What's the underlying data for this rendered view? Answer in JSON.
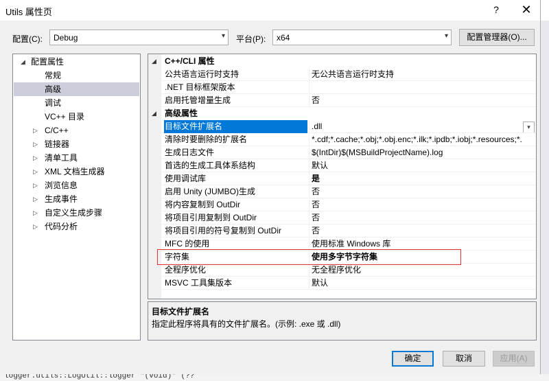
{
  "window": {
    "title": "Utils 属性页",
    "help_glyph": "?",
    "close_glyph": "✕"
  },
  "top": {
    "config_label": "配置(C):",
    "config_value": "Debug",
    "platform_label": "平台(P):",
    "platform_value": "x64",
    "config_manager_button": "配置管理器(O)..."
  },
  "tree": {
    "items": [
      {
        "label": "配置属性",
        "indent": 0,
        "twisty": "◢",
        "selected": false
      },
      {
        "label": "常规",
        "indent": 1,
        "twisty": "",
        "selected": false
      },
      {
        "label": "高级",
        "indent": 1,
        "twisty": "",
        "selected": true
      },
      {
        "label": "调试",
        "indent": 1,
        "twisty": "",
        "selected": false
      },
      {
        "label": "VC++ 目录",
        "indent": 1,
        "twisty": "",
        "selected": false
      },
      {
        "label": "C/C++",
        "indent": 1,
        "twisty": "▷",
        "selected": false
      },
      {
        "label": "链接器",
        "indent": 1,
        "twisty": "▷",
        "selected": false
      },
      {
        "label": "清单工具",
        "indent": 1,
        "twisty": "▷",
        "selected": false
      },
      {
        "label": "XML 文档生成器",
        "indent": 1,
        "twisty": "▷",
        "selected": false
      },
      {
        "label": "浏览信息",
        "indent": 1,
        "twisty": "▷",
        "selected": false
      },
      {
        "label": "生成事件",
        "indent": 1,
        "twisty": "▷",
        "selected": false
      },
      {
        "label": "自定义生成步骤",
        "indent": 1,
        "twisty": "▷",
        "selected": false
      },
      {
        "label": "代码分析",
        "indent": 1,
        "twisty": "▷",
        "selected": false
      }
    ]
  },
  "grid": {
    "sections": [
      {
        "title": "C++/CLI 属性",
        "twisty": "◢",
        "rows": [
          {
            "name": "公共语言运行时支持",
            "value": "无公共语言运行时支持",
            "bold": false
          },
          {
            "name": ".NET 目标框架版本",
            "value": "",
            "bold": false
          },
          {
            "name": "启用托管增量生成",
            "value": "否",
            "bold": false
          }
        ]
      },
      {
        "title": "高级属性",
        "twisty": "◢",
        "rows": [
          {
            "name": "目标文件扩展名",
            "value": ".dll",
            "bold": false,
            "selected": true
          },
          {
            "name": "清除时要删除的扩展名",
            "value": "*.cdf;*.cache;*.obj;*.obj.enc;*.ilk;*.ipdb;*.iobj;*.resources;*.",
            "bold": false
          },
          {
            "name": "生成日志文件",
            "value": "$(IntDir)$(MSBuildProjectName).log",
            "bold": false
          },
          {
            "name": "首选的生成工具体系结构",
            "value": "默认",
            "bold": false
          },
          {
            "name": "使用调试库",
            "value": "是",
            "bold": true
          },
          {
            "name": "启用 Unity (JUMBO)生成",
            "value": "否",
            "bold": false
          },
          {
            "name": "将内容复制到 OutDir",
            "value": "否",
            "bold": false
          },
          {
            "name": "将项目引用复制到 OutDir",
            "value": "否",
            "bold": false
          },
          {
            "name": "将项目引用的符号复制到 OutDir",
            "value": "否",
            "bold": false
          },
          {
            "name": "MFC 的使用",
            "value": "使用标准 Windows 库",
            "bold": false
          },
          {
            "name": "字符集",
            "value": "使用多字节字符集",
            "bold": true
          },
          {
            "name": "全程序优化",
            "value": "无全程序优化",
            "bold": false
          },
          {
            "name": "MSVC 工具集版本",
            "value": "默认",
            "bold": false
          }
        ]
      }
    ]
  },
  "description": {
    "title": "目标文件扩展名",
    "text": "指定此程序将具有的文件扩展名。(示例: .exe 或 .dll)"
  },
  "buttons": {
    "ok": "确定",
    "cancel": "取消",
    "apply": "应用(A)"
  },
  "background": {
    "bottom_text": "logger.utils::LogUtil::logger \"(void)\" (??"
  }
}
